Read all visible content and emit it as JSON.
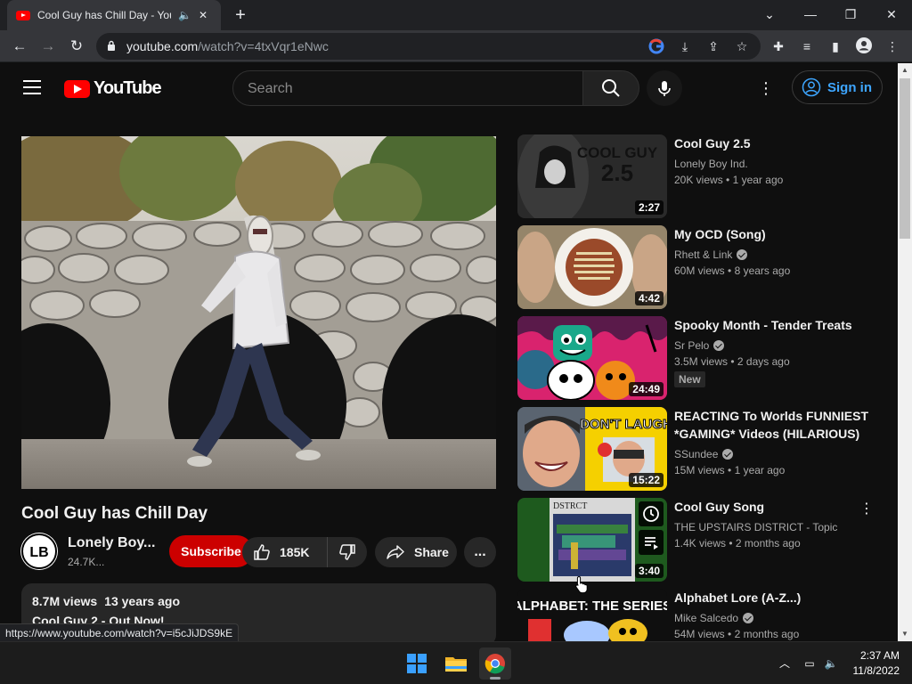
{
  "browser": {
    "tab_title": "Cool Guy has Chill Day - YouTube",
    "url_host": "youtube.com",
    "url_path": "/watch?v=4txVqr1eNwc",
    "status_url": "https://www.youtube.com/watch?v=i5cJiJDS9kE"
  },
  "masthead": {
    "logo_text": "YouTube",
    "search_placeholder": "Search",
    "signin_label": "Sign in"
  },
  "video": {
    "title": "Cool Guy has Chill Day",
    "channel": "Lonely Boy...",
    "channel_initials": "LB",
    "subscribers": "24.7K...",
    "subscribe_label": "Subscribe",
    "likes": "185K",
    "share_label": "Share",
    "more_label": "...",
    "views": "8.7M views",
    "age": "13 years ago",
    "description": "Cool Guy 2 - Out Now!"
  },
  "recommendations": [
    {
      "title": "Cool Guy 2.5",
      "channel": "Lonely Boy Ind.",
      "verified": false,
      "views": "20K views",
      "age": "1 year ago",
      "duration": "2:27",
      "thumb_text": "COOL GUY",
      "thumb_text2": "2.5"
    },
    {
      "title": "My OCD (Song)",
      "channel": "Rhett & Link",
      "verified": true,
      "views": "60M views",
      "age": "8 years ago",
      "duration": "4:42"
    },
    {
      "title": "Spooky Month - Tender Treats",
      "channel": "Sr Pelo",
      "verified": true,
      "views": "3.5M views",
      "age": "2 days ago",
      "duration": "24:49",
      "badge": "New"
    },
    {
      "title": "REACTING To Worlds FUNNIEST *GAMING* Videos (HILARIOUS)",
      "channel": "SSundee",
      "verified": true,
      "views": "15M views",
      "age": "1 year ago",
      "duration": "15:22",
      "thumb_text": "DON'T LAUGH"
    },
    {
      "title": "Cool Guy Song",
      "channel": "THE UPSTAIRS DISTRICT - Topic",
      "verified": false,
      "views": "1.4K views",
      "age": "2 months ago",
      "duration": "3:40",
      "thumb_text": "DSTRCT"
    },
    {
      "title": "Alphabet Lore (A-Z...)",
      "channel": "Mike Salcedo",
      "verified": true,
      "views": "54M views",
      "age": "2 months ago",
      "duration": "",
      "thumb_text": "ALPHABET: THE SERIES"
    }
  ],
  "taskbar": {
    "time": "2:37 AM",
    "date": "11/8/2022"
  },
  "colors": {
    "youtube_red": "#ff0000",
    "subscribe_red": "#cc0000",
    "link_blue": "#3ea6ff",
    "bg": "#0f0f0f"
  }
}
